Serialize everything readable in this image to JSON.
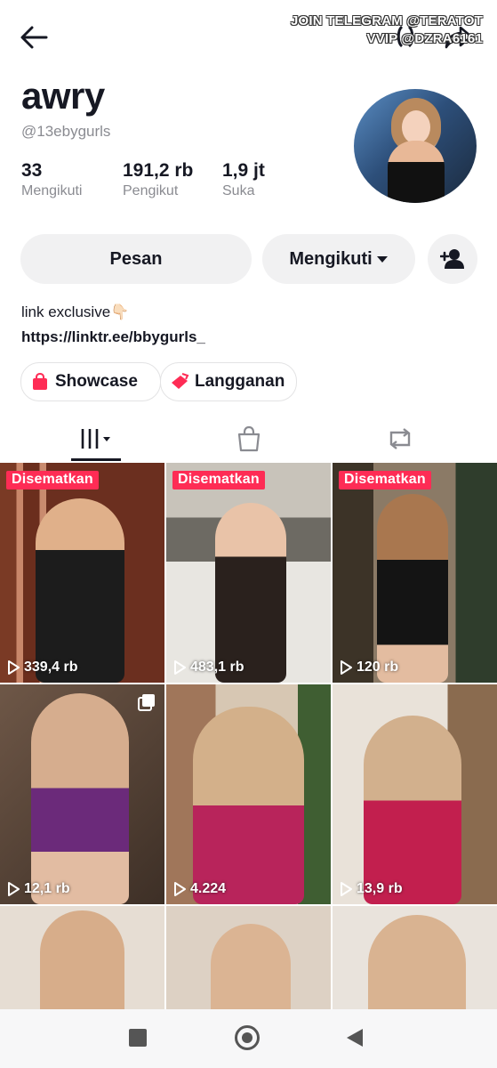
{
  "watermark": {
    "line1": "JOIN TELEGRAM @TERATOT",
    "line2": "VVIP @DZRA6161"
  },
  "profile": {
    "display_name": "awry",
    "username": "@13ebygurls",
    "stats": [
      {
        "value": "33",
        "label": "Mengikuti"
      },
      {
        "value": "191,2 rb",
        "label": "Pengikut"
      },
      {
        "value": "1,9 jt",
        "label": "Suka"
      }
    ]
  },
  "actions": {
    "message_label": "Pesan",
    "following_label": "Mengikuti"
  },
  "bio": {
    "text": "link exclusive👇🏻",
    "link": "https://linktr.ee/bbygurls_"
  },
  "chips": {
    "showcase": "Showcase",
    "langganan": "Langganan"
  },
  "videos": [
    {
      "pinned_label": "Disematkan",
      "views": "339,4 rb"
    },
    {
      "pinned_label": "Disematkan",
      "views": "483,1 rb"
    },
    {
      "pinned_label": "Disematkan",
      "views": "120 rb"
    },
    {
      "views": "12,1 rb"
    },
    {
      "views": "4.224"
    },
    {
      "views": "13,9 rb"
    },
    {
      "views": ""
    },
    {
      "views": ""
    },
    {
      "views": ""
    }
  ],
  "colors": {
    "accent": "#fe2c55",
    "text": "#161823",
    "muted": "#8a8b91",
    "button_bg": "#f1f1f2"
  },
  "icons": {
    "back": "arrow-left-icon",
    "share": "share-arrow-icon",
    "add_friend": "add-friend-icon",
    "tab_videos": "grid-icon",
    "tab_shop": "shopping-bag-icon",
    "tab_reposts": "repost-icon"
  }
}
